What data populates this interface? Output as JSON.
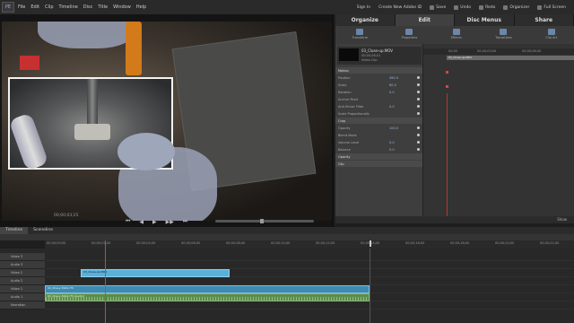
{
  "app": {
    "logo": "PE"
  },
  "menu": [
    "File",
    "Edit",
    "Clip",
    "Timeline",
    "Disc",
    "Title",
    "Window",
    "Help"
  ],
  "topbar": {
    "sign_in": "Sign In",
    "create_account": "Create New Adobe ID",
    "save": "Save",
    "undo": "Undo",
    "redo": "Redo",
    "organizer": "Organizer",
    "full_screen": "Full Screen"
  },
  "monitor": {
    "timecode": "00;00;03;25"
  },
  "panel_tabs": [
    "Organize",
    "Edit",
    "Disc Menus",
    "Share"
  ],
  "edit_tools": [
    "Transform",
    "Properties",
    "Effects",
    "Transitions",
    "Clip Art"
  ],
  "clip": {
    "name": "03_Close-up.MOV",
    "line2": "00;00;06;01",
    "line3": "Video Clip"
  },
  "properties": [
    {
      "label": "Motion",
      "header": true,
      "value": ""
    },
    {
      "label": "Position",
      "header": false,
      "value": "360.0"
    },
    {
      "label": "Scale",
      "header": false,
      "value": "60.0"
    },
    {
      "label": "Rotation",
      "header": false,
      "value": "0.0"
    },
    {
      "label": "Anchor Point",
      "header": false,
      "value": ""
    },
    {
      "label": "Anti-flicker Filter",
      "header": false,
      "value": "0.0"
    },
    {
      "label": "Scale Proportionally",
      "header": false,
      "value": ""
    },
    {
      "label": "Crop",
      "header": true,
      "value": ""
    },
    {
      "label": "Opacity",
      "header": false,
      "value": "100.0"
    },
    {
      "label": "Blend Mode",
      "header": false,
      "value": ""
    },
    {
      "label": "Volume Level",
      "header": false,
      "value": "0.0"
    },
    {
      "label": "Balance",
      "header": false,
      "value": "0.0"
    },
    {
      "label": "Opacity",
      "header": true,
      "value": ""
    },
    {
      "label": "Clip",
      "header": true,
      "value": ""
    }
  ],
  "keyframe": {
    "ruler": [
      "00;00",
      "00;00;03;00",
      "00;00;06;00"
    ],
    "clip_label": "03_Close-up.MOV",
    "show_label": "Show"
  },
  "timeline": {
    "tabs": [
      "Timeline",
      "Sceneline"
    ],
    "ruler": [
      "00;00;00;00",
      "00;00;02;00",
      "00;00;04;00",
      "00;00;06;00",
      "00;00;08;00",
      "00;00;10;00",
      "00;00;12;00",
      "00;00;14;00",
      "00;00;16;00",
      "00;00;18;00",
      "00;00;20;00",
      "00;00;22;00"
    ],
    "tracks": [
      "Video 3",
      "Audio 3",
      "Video 2",
      "Audio 2",
      "Video 1",
      "Audio 1",
      "Narration"
    ],
    "clips": {
      "video2": "03_Close-up.MOV",
      "video1": "02_Chevy-5910.ITS",
      "audio1": "03_Chevy-5910.ITS  [Audio]"
    }
  }
}
